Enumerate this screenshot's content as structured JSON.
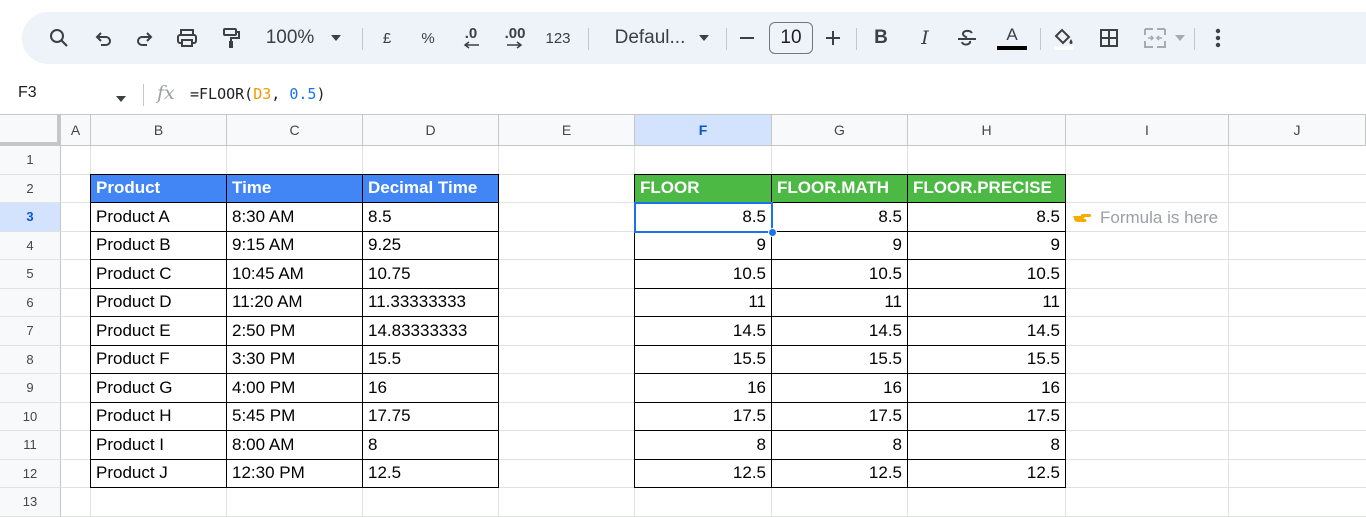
{
  "toolbar": {
    "zoom": "100%",
    "currency": "£",
    "percent": "%",
    "decrease_decimal": ".0",
    "increase_decimal": ".00",
    "number_format": "123",
    "font_name": "Defaul...",
    "font_size": "10",
    "bold": "B",
    "italic": "I",
    "text_color": "A"
  },
  "formula_bar": {
    "cell_ref": "F3",
    "fx": "fx",
    "formula_prefix": "=FLOOR(",
    "formula_ref": "D3",
    "formula_sep": ", ",
    "formula_num": "0.5",
    "formula_suffix": ")"
  },
  "columns": [
    "A",
    "B",
    "C",
    "D",
    "E",
    "F",
    "G",
    "H",
    "I",
    "J"
  ],
  "rows": [
    "1",
    "2",
    "3",
    "4",
    "5",
    "6",
    "7",
    "8",
    "9",
    "10",
    "11",
    "12",
    "13"
  ],
  "selected_cell": {
    "column": "F",
    "row": "3"
  },
  "left_table": {
    "headers": [
      "Product",
      "Time",
      "Decimal Time"
    ],
    "rows": [
      [
        "Product A",
        "8:30 AM",
        "8.5"
      ],
      [
        "Product B",
        "9:15 AM",
        "9.25"
      ],
      [
        "Product C",
        "10:45 AM",
        "10.75"
      ],
      [
        "Product D",
        "11:20 AM",
        "11.33333333"
      ],
      [
        "Product E",
        "2:50 PM",
        "14.83333333"
      ],
      [
        "Product F",
        "3:30 PM",
        "15.5"
      ],
      [
        "Product G",
        "4:00 PM",
        "16"
      ],
      [
        "Product H",
        "5:45 PM",
        "17.75"
      ],
      [
        "Product I",
        "8:00 AM",
        "8"
      ],
      [
        "Product J",
        "12:30 PM",
        "12.5"
      ]
    ]
  },
  "right_table": {
    "headers": [
      "FLOOR",
      "FLOOR.MATH",
      "FLOOR.PRECISE"
    ],
    "rows": [
      [
        "8.5",
        "8.5",
        "8.5"
      ],
      [
        "9",
        "9",
        "9"
      ],
      [
        "10.5",
        "10.5",
        "10.5"
      ],
      [
        "11",
        "11",
        "11"
      ],
      [
        "14.5",
        "14.5",
        "14.5"
      ],
      [
        "15.5",
        "15.5",
        "15.5"
      ],
      [
        "16",
        "16",
        "16"
      ],
      [
        "17.5",
        "17.5",
        "17.5"
      ],
      [
        "8",
        "8",
        "8"
      ],
      [
        "12.5",
        "12.5",
        "12.5"
      ]
    ]
  },
  "note": {
    "icon": "pointing-hand-icon",
    "text": "Formula is here"
  },
  "colors": {
    "header_blue": "#4285f4",
    "header_green": "#4cb944",
    "selection": "#1a73e8",
    "toolbar_bg": "#eef2f9",
    "formula_ref": "#f29900",
    "formula_number": "#1a73e8",
    "note_hand": "#f9ab00"
  }
}
